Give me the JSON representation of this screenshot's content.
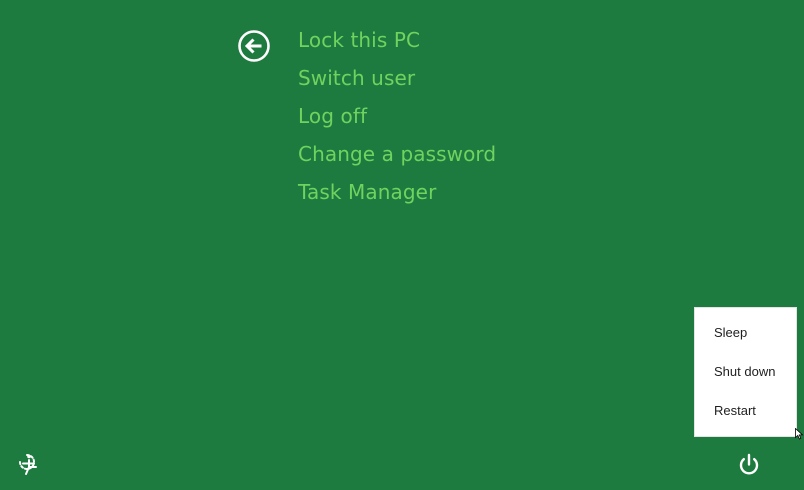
{
  "colors": {
    "background": "#1e7b3f",
    "menu_text": "#6fd35f",
    "icon_white": "#ffffff",
    "popup_background": "#ffffff",
    "popup_text": "#1f1f1f"
  },
  "icons": {
    "back": "back-arrow-circle-icon",
    "accessibility": "ease-of-access-icon",
    "power": "power-icon"
  },
  "security_menu": {
    "items": [
      {
        "label": "Lock this PC"
      },
      {
        "label": "Switch user"
      },
      {
        "label": "Log off"
      },
      {
        "label": "Change a password"
      },
      {
        "label": "Task Manager"
      }
    ]
  },
  "power_menu": {
    "items": [
      {
        "label": "Sleep"
      },
      {
        "label": "Shut down"
      },
      {
        "label": "Restart"
      }
    ]
  }
}
